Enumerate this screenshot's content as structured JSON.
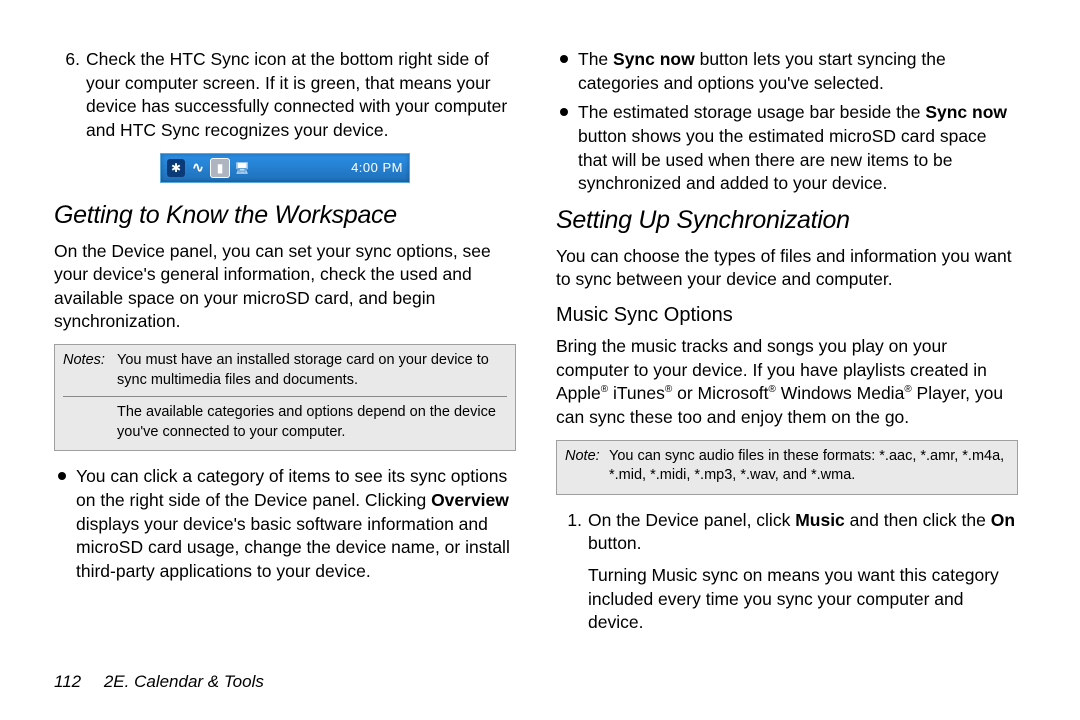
{
  "left": {
    "step6_num": "6.",
    "step6_a": "Check the HTC Sync icon at the bottom right side of your computer screen. If it is green, that means your device has successfully connected with your computer and HTC Sync recognizes your device.",
    "tray_time": "4:00 PM",
    "h_workspace": "Getting to Know the Workspace",
    "workspace_p": "On the Device panel, you can set your sync options, see your device's general information, check the used and available space on your microSD card, and begin synchronization.",
    "notes_label": "Notes:",
    "notes1": "You must have an installed storage card on your device to sync multimedia files and documents.",
    "notes2": "The available categories and options depend on the device you've connected to your computer.",
    "bul1_a": "You can click a category of items to see its sync options on the right side of the Device panel. Clicking ",
    "bul1_b": "Overview",
    "bul1_c": " displays your device's basic software information and microSD card usage, change the device name, or install third-party applications to your device."
  },
  "right": {
    "bul1_a": "The ",
    "bul1_b": "Sync now",
    "bul1_c": " button lets you start syncing the categories and options you've selected.",
    "bul2_a": "The estimated storage usage bar beside the ",
    "bul2_b": "Sync now",
    "bul2_c": " button shows you the estimated microSD card space that will be used when there are new items to be synchronized and added to your device.",
    "h_setup": "Setting Up Synchronization",
    "setup_p": "You can choose the types of files and information you want to sync between your device and computer.",
    "h_music": "Music Sync Options",
    "music_p_a": "Bring the music tracks and songs you play on your computer to your device. If you have playlists created in Apple",
    "music_p_b": " iTunes",
    "music_p_c": " or Microsoft",
    "music_p_d": " Windows Media",
    "music_p_e": " Player, you can sync these too and enjoy them on the go.",
    "note_label": "Note:",
    "note_text": "You can sync audio files in these formats: *.aac, *.amr, *.m4a, *.mid, *.midi, *.mp3, *.wav, and *.wma.",
    "step1_num": "1.",
    "step1_a": "On the Device panel, click ",
    "step1_b": "Music",
    "step1_c": " and then click the ",
    "step1_d": "On",
    "step1_e": " button.",
    "step1_p2": "Turning Music sync on means you want this category included every time you sync your computer and device."
  },
  "footer": {
    "page": "112",
    "section": "2E. Calendar & Tools"
  }
}
